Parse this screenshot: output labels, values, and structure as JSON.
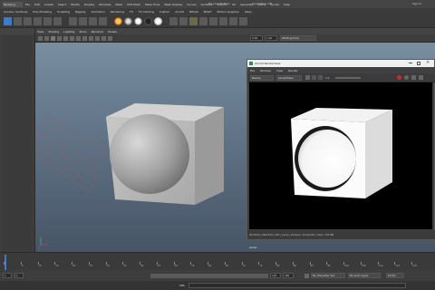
{
  "menubar": {
    "items": [
      "File",
      "Edit",
      "Create",
      "Select",
      "Modify",
      "Display",
      "Windows",
      "Mesh",
      "Edit Mesh",
      "Mesh Tools",
      "Mesh Display",
      "Curves",
      "Surfaces",
      "Deform",
      "UV",
      "Generate",
      "Cache",
      "Arnold",
      "Help"
    ],
    "workspace_label": "Modeling",
    "live_surface": "No Live Surface",
    "symmetry": "Symmetry: Off",
    "signin": "Sign In"
  },
  "shelf_tabs": [
    "Curves / Surfaces",
    "Poly Modeling",
    "Sculpting",
    "Rigging",
    "Animation",
    "Rendering",
    "FX",
    "FX Caching",
    "Custom",
    "Arnold",
    "Bifrost",
    "MASH",
    "Motion Graphics",
    "XGen"
  ],
  "viewport": {
    "menu": [
      "View",
      "Shading",
      "Lighting",
      "Show",
      "Renderer",
      "Panels"
    ],
    "fields": {
      "near": "0.00",
      "far": "1.00"
    },
    "color_space": "sRGB gamma",
    "camera_label": "persp"
  },
  "render_view": {
    "title": "Arnold RenderView",
    "menu": [
      "File",
      "Window",
      "View",
      "Render"
    ],
    "toolbar": {
      "aov": "Beauty",
      "camera": "perspShape",
      "zoom": "1:1"
    },
    "status": "00:00:02 | 960x540 | CPU | persp | Samples: 3/2/2/2/2/2 | Mem: 245 MB"
  },
  "timeline": {
    "frame_ticks": [
      "1",
      "5",
      "10",
      "15",
      "20",
      "25",
      "30",
      "35",
      "40",
      "45",
      "50",
      "55",
      "60",
      "65",
      "70",
      "75",
      "80",
      "85",
      "90",
      "95",
      "100",
      "105",
      "110",
      "115",
      "120"
    ],
    "current_frame": "1"
  },
  "range": {
    "start": "1",
    "start_inner": "1",
    "end_inner": "120",
    "end_outer": "200",
    "character_set": "No Character Set",
    "anim_layer": "No Anim Layer",
    "fps": "24 fps"
  },
  "cmdline": {
    "lang": "MEL"
  },
  "colors": {
    "accent": "#3d7cc9",
    "render_bg": "#000000"
  }
}
